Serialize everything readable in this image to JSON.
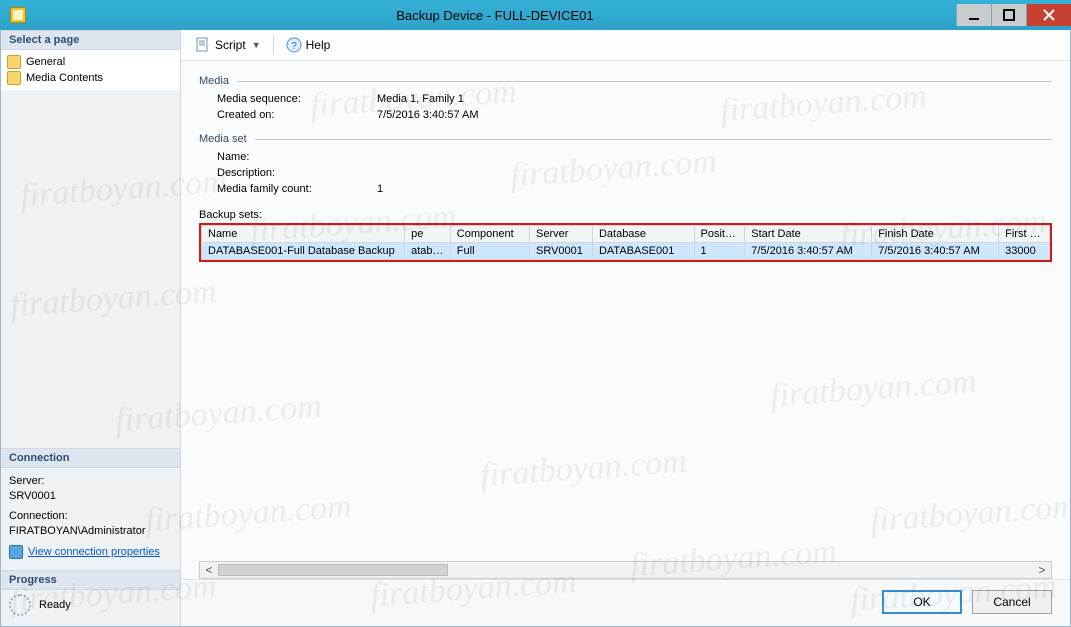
{
  "window": {
    "title": "Backup Device - FULL-DEVICE01"
  },
  "sidebar": {
    "select_page": "Select a page",
    "items": [
      {
        "label": "General"
      },
      {
        "label": "Media Contents"
      }
    ],
    "connection_header": "Connection",
    "server_label": "Server:",
    "server_value": "SRV0001",
    "connection_label": "Connection:",
    "connection_value": "FIRATBOYAN\\Administrator",
    "view_conn_props": "View connection properties",
    "progress_header": "Progress",
    "progress_status": "Ready"
  },
  "toolbar": {
    "script_label": "Script",
    "help_label": "Help"
  },
  "media": {
    "group_label": "Media",
    "seq_label": "Media sequence:",
    "seq_value": "Media 1, Family 1",
    "created_label": "Created on:",
    "created_value": "7/5/2016 3:40:57 AM"
  },
  "mediaset": {
    "group_label": "Media set",
    "name_label": "Name:",
    "name_value": "",
    "desc_label": "Description:",
    "desc_value": "",
    "count_label": "Media family count:",
    "count_value": "1"
  },
  "backup_sets": {
    "label": "Backup sets:",
    "columns": {
      "name": "Name",
      "pe": "pe",
      "component": "Component",
      "server": "Server",
      "database": "Database",
      "position": "Position",
      "start": "Start Date",
      "finish": "Finish Date",
      "first_lsn": "First LS"
    },
    "rows": [
      {
        "name": "DATABASE001-Full Database Backup",
        "pe": "atabase",
        "component": "Full",
        "server": "SRV0001",
        "database": "DATABASE001",
        "position": "1",
        "start": "7/5/2016 3:40:57 AM",
        "finish": "7/5/2016 3:40:57 AM",
        "first_lsn": "33000"
      }
    ]
  },
  "footer": {
    "ok": "OK",
    "cancel": "Cancel"
  },
  "watermark": "firatboyan.com"
}
